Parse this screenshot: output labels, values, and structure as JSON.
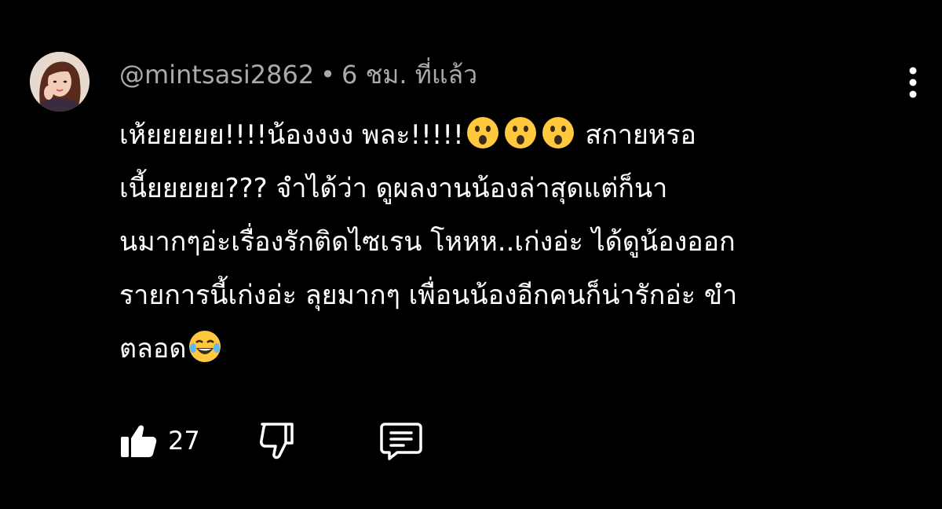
{
  "comment": {
    "author": "@mintsasi2862",
    "separator": "•",
    "time": "6 ชม. ที่แล้ว",
    "lines": {
      "l1a": "เห้ยยยยย!!!!น้องงงง  พละ!!!!!",
      "l1b": " สกายหรอ",
      "l2": "เนี้ยยยยย??? จำได้ว่า ดูผลงานน้องล่าสุดแต่ก็นา",
      "l3": "นมากๆอ่ะเรื่องรักติดไซเรน โหหห..เก่งอ่ะ ได้ดูน้องออก",
      "l4": "รายการนี้เก่งอ่ะ ลุยมากๆ เพื่อนน้องอีกคนก็น่ารักอ่ะ ขำ",
      "l5": "ตลอด"
    },
    "emojis": [
      "astonished-face",
      "astonished-face",
      "astonished-face",
      "tears-of-joy-face"
    ],
    "like_count": "27"
  },
  "icons": {
    "like": "thumbs-up-icon",
    "dislike": "thumbs-down-icon",
    "reply": "comment-reply-icon",
    "more": "more-vertical-icon"
  },
  "colors": {
    "background": "#000000",
    "text": "#ffffff",
    "meta_text": "#aaaaaa",
    "emoji_yellow": "#ffc83d"
  }
}
